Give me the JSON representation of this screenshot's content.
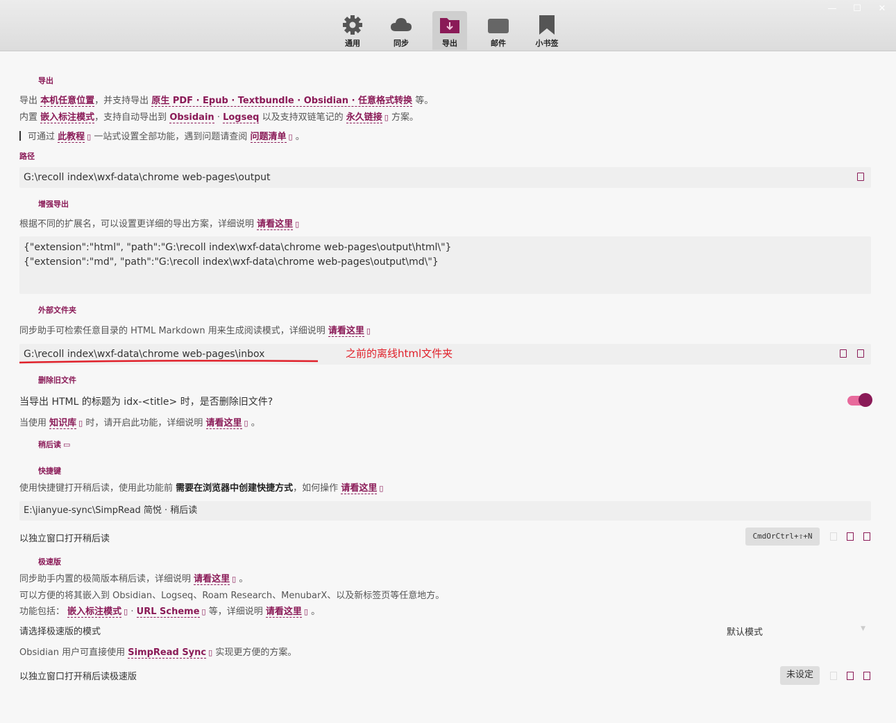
{
  "window": {
    "minimize": "—",
    "maximize": "☐",
    "close": "✕"
  },
  "tabs": [
    {
      "label": "通用",
      "icon": "gear-icon"
    },
    {
      "label": "同步",
      "icon": "cloud-icon"
    },
    {
      "label": "导出",
      "icon": "folder-download-icon",
      "active": true
    },
    {
      "label": "邮件",
      "icon": "mail-icon"
    },
    {
      "label": "小书签",
      "icon": "bookmark-icon"
    }
  ],
  "export": {
    "title": "导出",
    "line1": {
      "a": "导出",
      "link1": "本机任意位置",
      "b": "，并支持导出",
      "link2": "原生 PDF · Epub · Textbundle · Obsidian · 任意格式转换",
      "c": "等。"
    },
    "line2": {
      "a": "内置",
      "link1": "嵌入标注模式",
      "b": "，支持自动导出到",
      "link2": "Obsidain",
      "dot": "·",
      "link3": "Logseq",
      "c": "以及支持双链笔记的",
      "link4": "永久链接",
      "d": "方案。"
    },
    "line3": {
      "a": "可通过",
      "link1": "此教程",
      "b": "一站式设置全部功能，遇到问题请查阅",
      "link2": "问题清单",
      "c": "。"
    }
  },
  "path": {
    "label": "路径",
    "value": "G:\\recoll index\\wxf-data\\chrome web-pages\\output"
  },
  "enhanced": {
    "title": "增强导出",
    "desc": "根据不同的扩展名，可以设置更详细的导出方案，详细说明",
    "link": "请看这里",
    "line1": "{\"extension\":\"html\", \"path\":\"G:\\recoll index\\wxf-data\\chrome web-pages\\output\\html\\\"}",
    "line2": "{\"extension\":\"md\", \"path\":\"G:\\recoll index\\wxf-data\\chrome web-pages\\output\\md\\\"}"
  },
  "external": {
    "title": "外部文件夹",
    "desc": "同步助手可检索任意目录的 HTML Markdown 用来生成阅读模式，详细说明",
    "link": "请看这里",
    "value": "G:\\recoll index\\wxf-data\\chrome web-pages\\inbox",
    "annotation": "之前的离线html文件夹"
  },
  "delete_old": {
    "title": "删除旧文件",
    "question": "当导出 HTML 的标题为 idx-<title> 时，是否删除旧文件?",
    "toggle": true,
    "desc_a": "当使用",
    "link1": "知识库",
    "desc_b": "时，请开启此功能，详细说明",
    "link2": "请看这里",
    "desc_c": "。"
  },
  "read_later": {
    "title": "稍后读"
  },
  "shortcut": {
    "title": "快捷键",
    "desc_a": "使用快捷键打开稍后读，使用此功能前",
    "strong": "需要在浏览器中创建快捷方式",
    "desc_b": "，如何操作",
    "link": "请看这里",
    "value": "E:\\jianyue-sync\\SimpRead 简悦 · 稍后读",
    "open_label": "以独立窗口打开稍后读",
    "key": "CmdOrCtrl+⇧+N"
  },
  "lite": {
    "title": "极速版",
    "desc1_a": "同步助手内置的极简版本稍后读，详细说明",
    "desc1_link": "请看这里",
    "desc1_c": "。",
    "desc2": "可以方便的将其嵌入到 Obsidian、Logseq、Roam Research、MenubarX、以及新标签页等任意地方。",
    "desc3_a": "功能包括：",
    "desc3_link1": "嵌入标注模式",
    "desc3_dot": "·",
    "desc3_link2": "URL Scheme",
    "desc3_b": "等，详细说明",
    "desc3_link3": "请看这里",
    "desc3_c": "。",
    "mode_label": "请选择极速版的模式",
    "mode_value": "默认模式",
    "obsidian_a": "Obsidian 用户可直接使用",
    "obsidian_link": "SimpRead Sync",
    "obsidian_b": "实现更方便的方案。",
    "open_label": "以独立窗口打开稍后读极速版",
    "key": "未设定"
  }
}
